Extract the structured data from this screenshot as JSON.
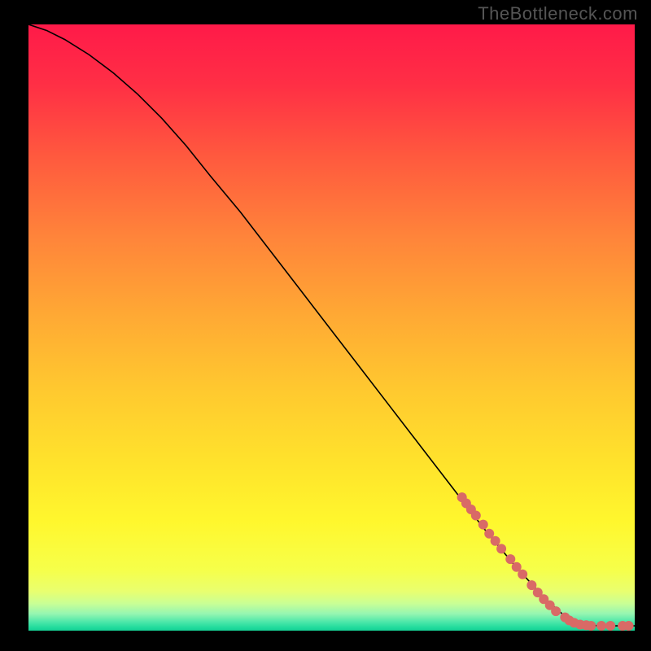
{
  "watermark": "TheBottleneck.com",
  "chart_data": {
    "type": "line",
    "title": "",
    "xlabel": "",
    "ylabel": "",
    "xlim": [
      0,
      100
    ],
    "ylim": [
      0,
      100
    ],
    "grid": false,
    "series": [
      {
        "name": "curve",
        "x": [
          0,
          3,
          6,
          10,
          14,
          18,
          22,
          26,
          30,
          35,
          40,
          45,
          50,
          55,
          60,
          65,
          70,
          75,
          80,
          85,
          88,
          90,
          92,
          94,
          96,
          98,
          100
        ],
        "y": [
          100,
          99,
          97.5,
          95,
          92,
          88.5,
          84.5,
          80,
          75,
          69,
          62.5,
          56,
          49.5,
          43,
          36.5,
          30,
          23.5,
          17,
          11,
          5.5,
          2.8,
          1.6,
          1.0,
          0.8,
          0.8,
          0.8,
          0.8
        ]
      }
    ],
    "highlight_points": {
      "name": "markers",
      "coords": [
        [
          71.5,
          22.0
        ],
        [
          72.2,
          21.0
        ],
        [
          73.0,
          20.0
        ],
        [
          73.8,
          19.0
        ],
        [
          75.0,
          17.5
        ],
        [
          76.0,
          16.0
        ],
        [
          77.0,
          14.8
        ],
        [
          78.0,
          13.5
        ],
        [
          79.5,
          11.8
        ],
        [
          80.5,
          10.5
        ],
        [
          81.5,
          9.3
        ],
        [
          83.0,
          7.5
        ],
        [
          84.0,
          6.3
        ],
        [
          85.0,
          5.2
        ],
        [
          86.0,
          4.2
        ],
        [
          87.0,
          3.2
        ],
        [
          88.5,
          2.2
        ],
        [
          89.2,
          1.7
        ],
        [
          90.0,
          1.3
        ],
        [
          91.0,
          1.0
        ],
        [
          92.0,
          0.9
        ],
        [
          92.8,
          0.8
        ],
        [
          94.5,
          0.8
        ],
        [
          96.0,
          0.8
        ],
        [
          98.0,
          0.8
        ],
        [
          99.0,
          0.8
        ]
      ]
    },
    "gradient_stops": [
      {
        "offset": 0.0,
        "color": "#ff1a49"
      },
      {
        "offset": 0.1,
        "color": "#ff2f45"
      },
      {
        "offset": 0.22,
        "color": "#ff5a3e"
      },
      {
        "offset": 0.35,
        "color": "#ff843a"
      },
      {
        "offset": 0.48,
        "color": "#ffa934"
      },
      {
        "offset": 0.6,
        "color": "#ffc82f"
      },
      {
        "offset": 0.72,
        "color": "#ffe22c"
      },
      {
        "offset": 0.82,
        "color": "#fff72d"
      },
      {
        "offset": 0.9,
        "color": "#f6ff4a"
      },
      {
        "offset": 0.935,
        "color": "#e9ff6f"
      },
      {
        "offset": 0.955,
        "color": "#c9ff95"
      },
      {
        "offset": 0.972,
        "color": "#96f6b1"
      },
      {
        "offset": 0.985,
        "color": "#4fe8aa"
      },
      {
        "offset": 0.995,
        "color": "#20db9c"
      },
      {
        "offset": 1.0,
        "color": "#15d195"
      }
    ],
    "marker_color": "#d96a66",
    "line_color": "#000000"
  }
}
